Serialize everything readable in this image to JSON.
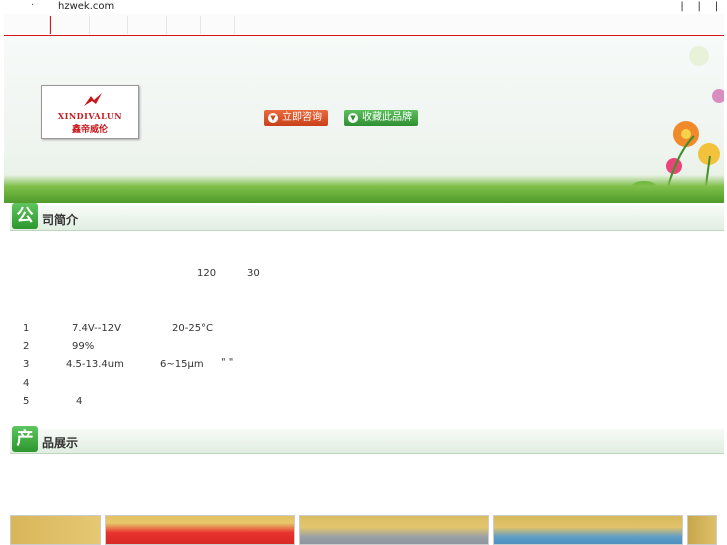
{
  "topbar": {
    "bullet": "·",
    "site": "hzwek.com",
    "links": [
      "|",
      "|",
      "|"
    ]
  },
  "nav": {
    "tabs": [
      "",
      "",
      "",
      "",
      "",
      ""
    ],
    "accent_color": "#d6121b"
  },
  "banner": {
    "logo": {
      "brand_en": "XINDIVALUN",
      "brand_cn": "鑫帝威伦"
    },
    "buttons": {
      "consult": "立即咨询",
      "favorite": "收藏此品牌"
    }
  },
  "company": {
    "badge": "公",
    "title": "司简介",
    "intro_values": [
      "120",
      "30"
    ],
    "list": [
      {
        "index": "1",
        "a": "7.4V--12V",
        "b": "20-25°C",
        "c": ""
      },
      {
        "index": "2",
        "a": "99%",
        "b": "",
        "c": ""
      },
      {
        "index": "3",
        "a": "4.5-13.4um",
        "b": "6~15μm",
        "c": "\"   \""
      },
      {
        "index": "4",
        "a": "",
        "b": "",
        "c": ""
      },
      {
        "index": "5",
        "a": "4",
        "b": "",
        "c": ""
      }
    ]
  },
  "products": {
    "badge": "产",
    "title": "品展示",
    "images": [
      "red-fabric-photo",
      "grey-fabric-photo",
      "blue-fabric-photo"
    ]
  },
  "colors": {
    "green": "#2e962e",
    "red": "#d6121b"
  }
}
